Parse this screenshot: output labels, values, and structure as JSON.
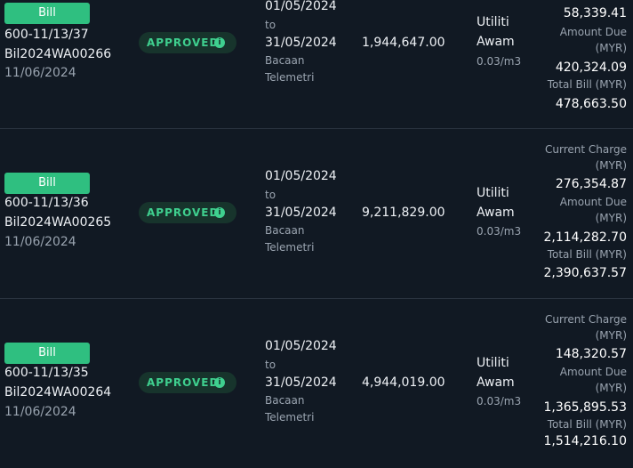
{
  "bills": [
    {
      "badge": "Bill",
      "account": "600-11/13/37",
      "bill_no": "Bil2024WA00266",
      "bill_date": "11/06/2024",
      "status": "APPROVED",
      "period_from": "01/05/2024",
      "period_to_word": "to",
      "period_to": "31/05/2024",
      "reading_method_1": "Bacaan",
      "reading_method_2": "Telemetri",
      "consumption": "1,944,647.00",
      "category_1": "Utiliti",
      "category_2": "Awam",
      "rate": "0.03/m3",
      "current_charge": "58,339.41",
      "amount_due_label_1": "Amount Due",
      "amount_due_label_2": "(MYR)",
      "amount_due": "420,324.09",
      "total_bill_label": "Total Bill (MYR)",
      "total_bill": "478,663.50"
    },
    {
      "badge": "Bill",
      "account": "600-11/13/36",
      "bill_no": "Bil2024WA00265",
      "bill_date": "11/06/2024",
      "status": "APPROVED",
      "period_from": "01/05/2024",
      "period_to_word": "to",
      "period_to": "31/05/2024",
      "reading_method_1": "Bacaan",
      "reading_method_2": "Telemetri",
      "consumption": "9,211,829.00",
      "category_1": "Utiliti",
      "category_2": "Awam",
      "rate": "0.03/m3",
      "current_charge_label_1": "Current Charge",
      "current_charge_label_2": "(MYR)",
      "current_charge": "276,354.87",
      "amount_due_label_1": "Amount Due",
      "amount_due_label_2": "(MYR)",
      "amount_due": "2,114,282.70",
      "total_bill_label": "Total Bill (MYR)",
      "total_bill": "2,390,637.57"
    },
    {
      "badge": "Bill",
      "account": "600-11/13/35",
      "bill_no": "Bil2024WA00264",
      "bill_date": "11/06/2024",
      "status": "APPROVED",
      "period_from": "01/05/2024",
      "period_to_word": "to",
      "period_to": "31/05/2024",
      "reading_method_1": "Bacaan",
      "reading_method_2": "Telemetri",
      "consumption": "4,944,019.00",
      "category_1": "Utiliti",
      "category_2": "Awam",
      "rate": "0.03/m3",
      "current_charge_label_1": "Current Charge",
      "current_charge_label_2": "(MYR)",
      "current_charge": "148,320.57",
      "amount_due_label_1": "Amount Due",
      "amount_due_label_2": "(MYR)",
      "amount_due": "1,365,895.53",
      "total_bill_label": "Total Bill (MYR)",
      "total_bill": "1,514,216.10"
    }
  ],
  "info_icon_glyph": "i",
  "colors": {
    "background": "#111923",
    "bill_badge": "#2fbf80",
    "approved_bg": "#17342c",
    "approved_text": "#3fd08f",
    "muted_text": "#9aa4b0"
  }
}
